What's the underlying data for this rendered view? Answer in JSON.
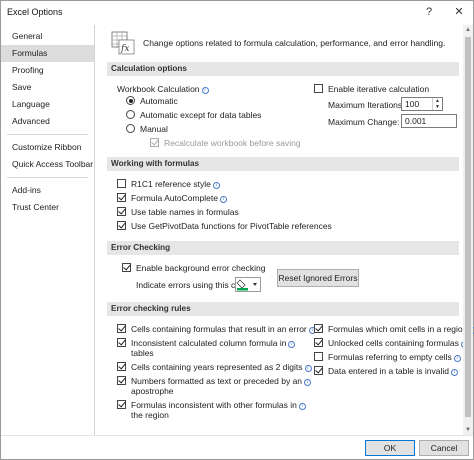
{
  "window": {
    "title": "Excel Options",
    "help": "?",
    "close": "✕"
  },
  "sidebar": {
    "items": [
      {
        "label": "General"
      },
      {
        "label": "Formulas"
      },
      {
        "label": "Proofing"
      },
      {
        "label": "Save"
      },
      {
        "label": "Language"
      },
      {
        "label": "Advanced"
      },
      {
        "label": "Customize Ribbon"
      },
      {
        "label": "Quick Access Toolbar"
      },
      {
        "label": "Add-ins"
      },
      {
        "label": "Trust Center"
      }
    ],
    "selected_index": 1
  },
  "header": {
    "text": "Change options related to formula calculation, performance, and error handling."
  },
  "calc": {
    "title": "Calculation options",
    "workbook_label": "Workbook Calculation",
    "automatic": "Automatic",
    "automatic_except": "Automatic except for data tables",
    "manual": "Manual",
    "recalc": "Recalculate workbook before saving",
    "iterative": "Enable iterative calculation",
    "max_iter_label": "Maximum Iterations:",
    "max_iter_value": "100",
    "max_change_label": "Maximum Change:",
    "max_change_value": "0.001"
  },
  "formulas": {
    "title": "Working with formulas",
    "r1c1": "R1C1 reference style",
    "autocomplete": "Formula AutoComplete",
    "table_names": "Use table names in formulas",
    "getpivot": "Use GetPivotData functions for PivotTable references"
  },
  "errorcheck": {
    "title": "Error Checking",
    "enable_bg": "Enable background error checking",
    "indicate": "Indicate errors using this color:",
    "reset": "Reset Ignored Errors"
  },
  "rules": {
    "title": "Error checking rules",
    "left": [
      {
        "text": "Cells containing formulas that result in an error"
      },
      {
        "text": "Inconsistent calculated column formula in",
        "text2": "tables"
      },
      {
        "text": "Cells containing years represented as 2 digits"
      },
      {
        "text": "Numbers formatted as text or preceded by an",
        "text2": "apostrophe"
      },
      {
        "text": "Formulas inconsistent with other formulas in",
        "text2": "the region"
      }
    ],
    "right": [
      {
        "text": "Formulas which omit cells in a region"
      },
      {
        "text": "Unlocked cells containing formulas"
      },
      {
        "text": "Formulas referring to empty cells"
      },
      {
        "text": "Data entered in a table is invalid"
      }
    ]
  },
  "footer": {
    "ok": "OK",
    "cancel": "Cancel"
  },
  "colors": {
    "accent": "#0078d7",
    "section_bg": "#e6e6e6",
    "selected_bg": "#dcdcdc",
    "error_indicator": "#00a651"
  }
}
